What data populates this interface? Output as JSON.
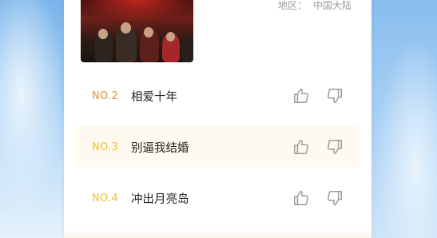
{
  "region": {
    "label": "地区：",
    "value": "中国大陆"
  },
  "poster": {
    "icon": "movie-poster"
  },
  "rankings": [
    {
      "rank": "NO.2",
      "title": "相爱十年",
      "rank_color": "#e59138"
    },
    {
      "rank": "NO.3",
      "title": "别逼我结婚",
      "rank_color": "#f2bd2d"
    },
    {
      "rank": "NO.4",
      "title": "冲出月亮岛",
      "rank_color": "#f2bd2d"
    }
  ],
  "icons": {
    "like": "thumbs-up-icon",
    "dislike": "thumbs-down-icon"
  }
}
